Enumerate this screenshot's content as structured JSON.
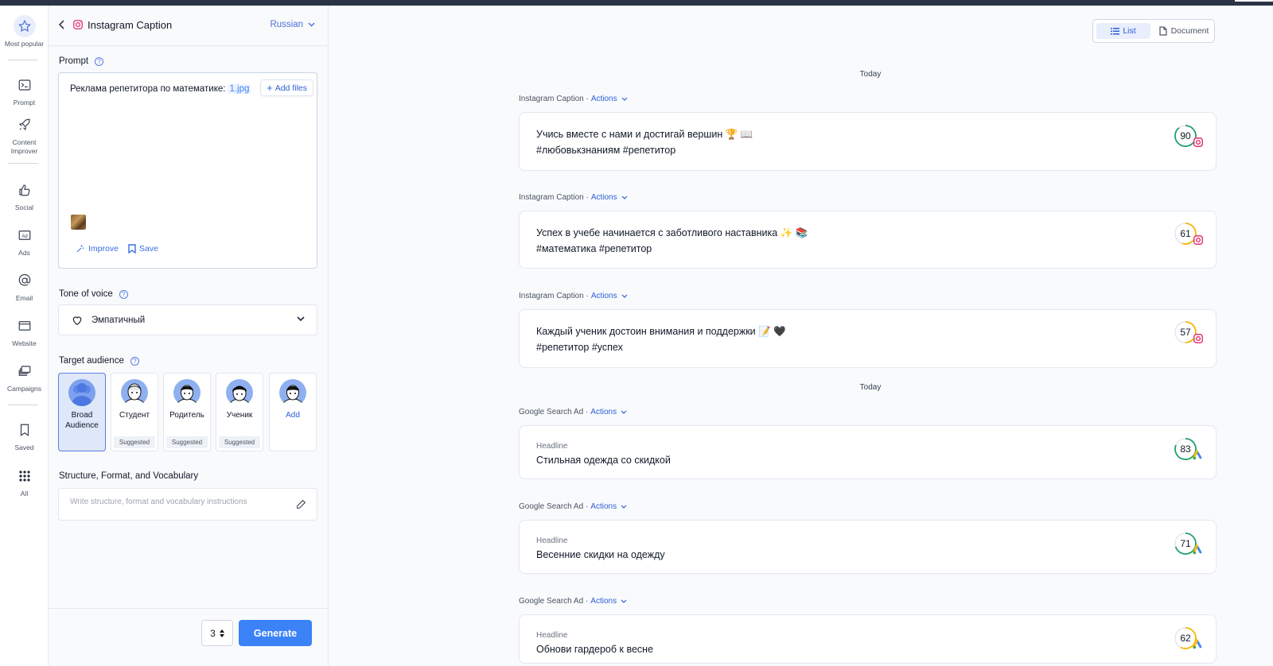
{
  "sidebar": {
    "items": [
      {
        "label": "Most popular",
        "icon": "star-icon"
      },
      {
        "label": "Prompt",
        "icon": "terminal-icon"
      },
      {
        "label": "Content Improver",
        "icon": "rocket-icon"
      },
      {
        "label": "Social",
        "icon": "thumbs-up-icon"
      },
      {
        "label": "Ads",
        "icon": "ad-icon"
      },
      {
        "label": "Email",
        "icon": "at-icon"
      },
      {
        "label": "Website",
        "icon": "browser-icon"
      },
      {
        "label": "Campaigns",
        "icon": "layers-icon"
      },
      {
        "label": "Saved",
        "icon": "bookmark-icon"
      },
      {
        "label": "All",
        "icon": "grid-icon"
      }
    ]
  },
  "panel": {
    "title": "Instagram Caption",
    "language": "Russian",
    "prompt_label": "Prompt",
    "prompt_text": "Реклама репетитора по математике:",
    "file_chip": "1.jpg",
    "add_files": "Add files",
    "improve": "Improve",
    "save": "Save",
    "tone_label": "Tone of voice",
    "tone_value": "Эмпатичный",
    "audience_label": "Target audience",
    "audiences": [
      {
        "name": "Broad Audience",
        "badge": ""
      },
      {
        "name": "Студент",
        "badge": "Suggested"
      },
      {
        "name": "Родитель",
        "badge": "Suggested"
      },
      {
        "name": "Ученик",
        "badge": "Suggested"
      },
      {
        "name": "Add",
        "badge": ""
      }
    ],
    "structure_label": "Structure, Format, and Vocabulary",
    "structure_placeholder": "Write structure, format and vocabulary instructions",
    "count": "3",
    "generate": "Generate"
  },
  "main": {
    "view_list": "List",
    "view_document": "Document",
    "date_label": "Today",
    "actions_label": "Actions",
    "results": [
      {
        "type": "Instagram Caption",
        "lines": [
          "Учись вместе с нами и достигай вершин 🏆 📖",
          "#любовькзнаниям #репетитор"
        ],
        "score": 90,
        "score_color": "#22a06b",
        "brand": "instagram"
      },
      {
        "type": "Instagram Caption",
        "lines": [
          "Успех в учебе начинается с заботливого наставника ✨ 📚",
          "#математика #репетитор"
        ],
        "score": 61,
        "score_color": "#f5b700",
        "brand": "instagram"
      },
      {
        "type": "Instagram Caption",
        "lines": [
          "Каждый ученик достоин внимания и поддержки 📝 🖤",
          "#репетитор #успех"
        ],
        "score": 57,
        "score_color": "#f5b700",
        "brand": "instagram"
      },
      {
        "type": "Google Search Ad",
        "sub": "Headline",
        "lines": [
          "Стильная одежда со скидкой"
        ],
        "score": 83,
        "score_color": "#22a06b",
        "brand": "google-ads"
      },
      {
        "type": "Google Search Ad",
        "sub": "Headline",
        "lines": [
          "Весенние скидки на одежду"
        ],
        "score": 71,
        "score_color": "#22a06b",
        "brand": "google-ads"
      },
      {
        "type": "Google Search Ad",
        "sub": "Headline",
        "lines": [
          "Обнови гардероб к весне"
        ],
        "score": 62,
        "score_color": "#f5b700",
        "brand": "google-ads"
      }
    ]
  }
}
